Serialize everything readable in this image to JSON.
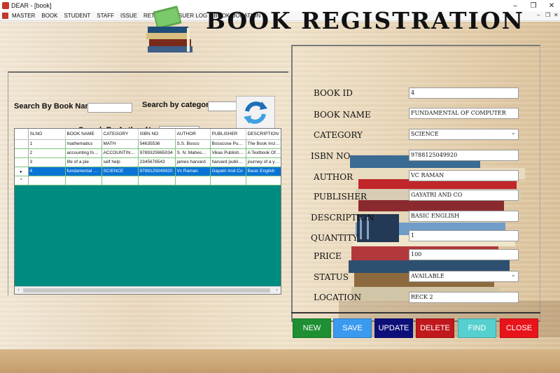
{
  "window": {
    "title": "DEAR - [book]"
  },
  "menu": [
    "MASTER",
    "BOOK",
    "STUDENT",
    "STAFF",
    "ISSUE",
    "RETURN",
    "ISSUER LOG",
    "BOOK DONATION"
  ],
  "header": {
    "title": "BOOK REGISTRATION"
  },
  "search": {
    "book_name_label": "Search By Book Name",
    "category_label": "Search by category",
    "author_label": "Search By Author Name",
    "book_name_value": "",
    "category_value": "",
    "author_value": ""
  },
  "grid": {
    "columns": [
      "SLNO",
      "BOOK NAME",
      "CATEGORY",
      "ISBN NO",
      "AUTHOR",
      "PUBLISHER",
      "DESCRIPTION"
    ],
    "rows": [
      [
        "1",
        "mathematics",
        "MATH",
        "54635536",
        "S.S. Bosco",
        "Bosscose Publica...",
        "The Book Includ..."
      ],
      [
        "2",
        "accounting for m...",
        "ACCOUNTING &...",
        "9789325965034",
        "S. N. Maheshwar...",
        "Vikas Publishing ...",
        "A Textbook Of A..."
      ],
      [
        "3",
        "life of a pie",
        "self help",
        "2345676543",
        "james harvard",
        "harvard publishers",
        "journey of a youn..."
      ],
      [
        "4",
        "fundamental of c...",
        "SCIENCE",
        "9788125049920",
        "Vc Raman",
        "Gayatri And Co",
        "Basic English"
      ]
    ],
    "selected_row": 3,
    "current_row_marker": "▸",
    "new_row_marker": "*"
  },
  "form": {
    "book_id_label": "BOOK ID",
    "book_id": "4",
    "book_name_label": "BOOK NAME",
    "book_name": "FUNDAMENTAL OF COMPUTER",
    "category_label": "CATEGORY",
    "category": "SCIENCE",
    "isbn_label": "ISBN NO",
    "isbn": "9788125049920",
    "author_label": "AUTHOR",
    "author": "VC RAMAN",
    "publisher_label": "PUBLISHER",
    "publisher": "GAYATRI AND CO",
    "description_label": "DESCRIPTION",
    "description": "BASIC ENGLISH",
    "quantity_label": "QUANTITY",
    "quantity": "1",
    "price_label": "PRICE",
    "price": "100",
    "status_label": "STATUS",
    "status": "AVAILABLE",
    "location_label": "LOCATION",
    "location": "RECK 2"
  },
  "buttons": {
    "new": "NEW",
    "save": "SAVE",
    "update": "UPDATE",
    "delete": "DELETE",
    "find": "FIND",
    "close": "CLOSE"
  },
  "colors": {
    "new": "#1e8f33",
    "save": "#3a9af0",
    "update": "#0e0e7a",
    "delete": "#c0181c",
    "find": "#55d0cf",
    "close": "#e8141a",
    "grid_bg": "#008b80",
    "selection": "#0a74d6"
  },
  "icons": [
    "app-icon",
    "minimize-icon",
    "restore-icon",
    "close-icon",
    "books-logo-icon",
    "refresh-icon",
    "chevron-down-icon"
  ]
}
